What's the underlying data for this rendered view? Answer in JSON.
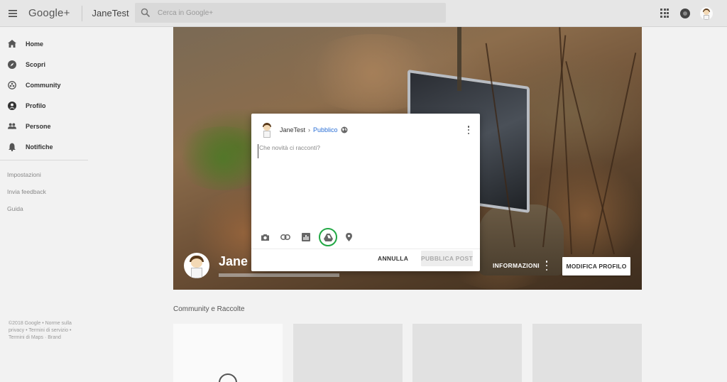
{
  "header": {
    "logo": "Google+",
    "title": "JaneTest",
    "search_placeholder": "Cerca in Google+"
  },
  "sidebar": {
    "items": [
      {
        "label": "Home",
        "icon": "home-icon"
      },
      {
        "label": "Scopri",
        "icon": "compass-icon"
      },
      {
        "label": "Community",
        "icon": "community-icon"
      },
      {
        "label": "Profilo",
        "icon": "profile-icon"
      },
      {
        "label": "Persone",
        "icon": "people-icon"
      },
      {
        "label": "Notifiche",
        "icon": "bell-icon"
      }
    ],
    "links": [
      "Impostazioni",
      "Invia feedback",
      "Guida"
    ],
    "footer": "©2018 Google • Norme sulla privacy • Termini di servizio • Termini di Maps · Brand"
  },
  "profile": {
    "name": "Jane",
    "info_label": "INFORMAZIONI",
    "edit_label": "MODIFICA PROFILO"
  },
  "composer": {
    "user": "JaneTest",
    "separator": "›",
    "audience": "Pubblico",
    "placeholder": "Che novità ci racconti?",
    "tools": [
      "camera-icon",
      "link-icon",
      "poll-icon",
      "drive-icon",
      "location-icon"
    ],
    "highlight_color": "#22a845",
    "cancel_label": "ANNULLA",
    "publish_label": "PUBBLICA POST"
  },
  "collections": {
    "title": "Community e Raccolte"
  },
  "colors": {
    "link": "#2a6fd6",
    "header_bg": "#e6e6e6"
  }
}
